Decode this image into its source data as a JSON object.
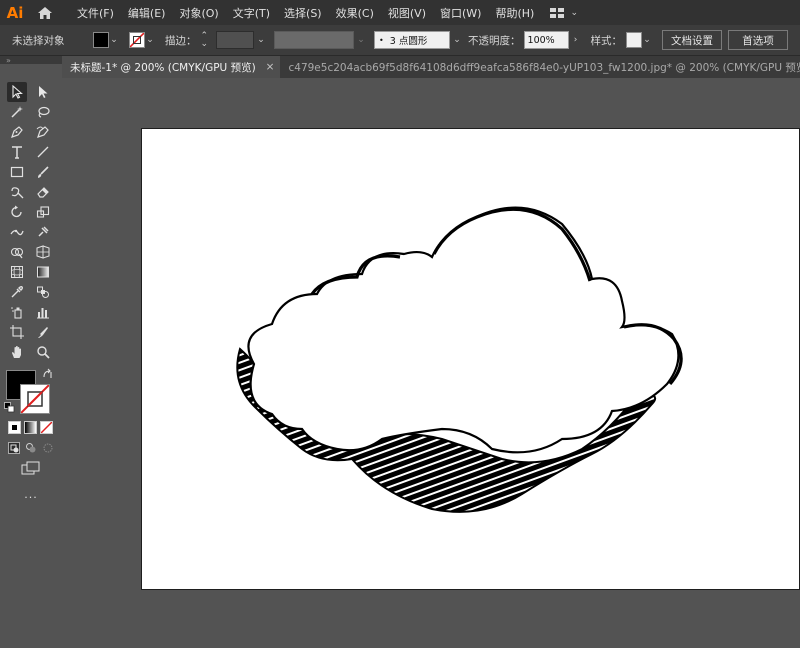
{
  "app": {
    "logo": "Ai"
  },
  "menu": {
    "items": [
      "文件(F)",
      "编辑(E)",
      "对象(O)",
      "文字(T)",
      "选择(S)",
      "效果(C)",
      "视图(V)",
      "窗口(W)",
      "帮助(H)"
    ]
  },
  "control_bar": {
    "selection_label": "未选择对象",
    "stroke_label": "描边：",
    "brush_value": "3 点圆形",
    "opacity_label": "不透明度：",
    "opacity_value": "100%",
    "style_label": "样式：",
    "doc_setup_button": "文档设置",
    "preferences_button": "首选项"
  },
  "tabs": [
    {
      "label": "未标题-1* @ 200% (CMYK/GPU 预览)",
      "close": "×"
    },
    {
      "label": "c479e5c204acb69f5d8f64108d6dff9eafca586f84e0-yUP103_fw1200.jpg* @ 200% (CMYK/GPU 预览)"
    }
  ],
  "toolbar": {
    "more_label": "..."
  },
  "colors": {
    "accent": "#ff7c00",
    "menubar": "#323232",
    "panel": "#535353",
    "artboard": "#ffffff"
  }
}
